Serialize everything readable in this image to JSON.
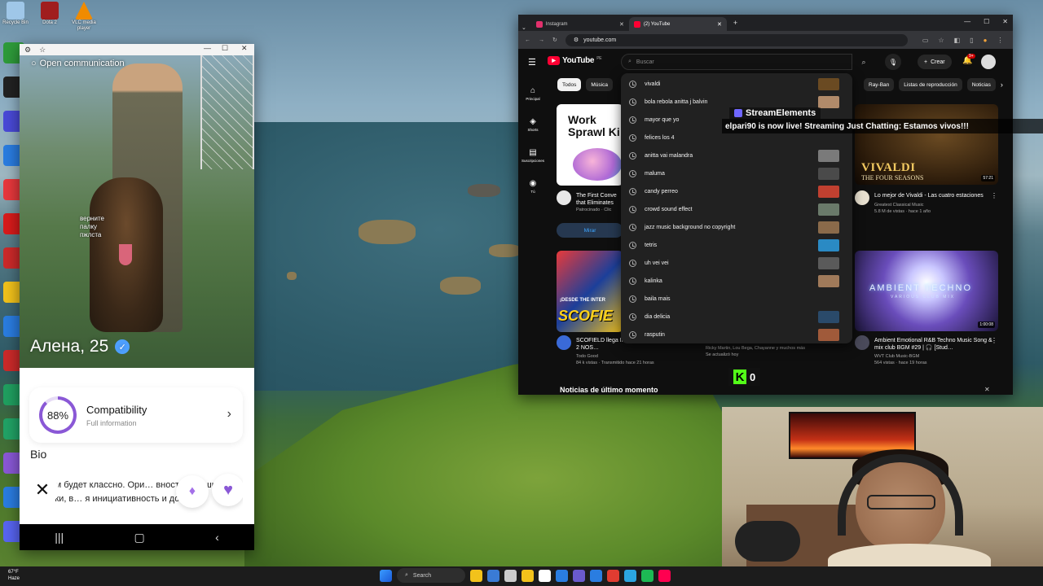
{
  "desktop": {
    "top_icons": [
      {
        "label": "Recycle Bin",
        "color": "#9fc7e8"
      },
      {
        "label": "Dota 2",
        "color": "#a01e1e"
      },
      {
        "label": "VLC media player",
        "color": "#f08b00"
      }
    ],
    "side_icon_colors": [
      "#2e9b3a",
      "#222222",
      "#4a4ad8",
      "#2a7de1",
      "#e8383c",
      "#d81b1b",
      "#cc2a2a",
      "#f2c21b",
      "#2a7de1",
      "#cc2a2a",
      "#20a060",
      "#21a366",
      "#8a58d6",
      "#2a7de1",
      "#5865f2"
    ]
  },
  "phone": {
    "overlay_title": "Open communication",
    "side_note": "верните\nпалку\nпжлста",
    "name": "Алена, 25",
    "verified_icon": "verified-check-icon",
    "compatibility": {
      "percent": "88%",
      "percent_value": 0.88,
      "title": "Compatibility",
      "subtitle": "Full information"
    },
    "bio_label": "Bio",
    "bio_text": "с кем будет классно. Ори… вность, смешные шутки, в… я инициативность и долька",
    "accent": "#8a58d6"
  },
  "browser": {
    "tabs": [
      {
        "label": "Instagram",
        "color": "#e1306c"
      },
      {
        "label": "(2) YouTube",
        "color": "#ff0033"
      }
    ],
    "url": "youtube.com",
    "youtube": {
      "logo": "YouTube",
      "country": "PE",
      "search_placeholder": "Buscar",
      "create_label": "Crear",
      "notif_count": "9+",
      "sidebar": [
        {
          "icon": "home-icon",
          "glyph": "⌂",
          "label": "Principal"
        },
        {
          "icon": "shorts-icon",
          "glyph": "◈",
          "label": "Shorts"
        },
        {
          "icon": "subscriptions-icon",
          "glyph": "▤",
          "label": "Suscripciones"
        },
        {
          "icon": "you-icon",
          "glyph": "◉",
          "label": "Tú"
        }
      ],
      "chips_left": [
        "Todos",
        "Música"
      ],
      "chips_right": [
        "Ray-Ban",
        "Listas de reproducción",
        "Noticias"
      ],
      "suggestions": [
        {
          "text": "vivaldi",
          "thumb": "#6a4a22"
        },
        {
          "text": "bola rebola anitta j balvin",
          "thumb": "#b08a6a"
        },
        {
          "text": "mayor que yo",
          "thumb": ""
        },
        {
          "text": "felices los 4",
          "thumb": ""
        },
        {
          "text": "anitta vai malandra",
          "thumb": "#7a7a7a"
        },
        {
          "text": "maluma",
          "thumb": "#4a4a4a"
        },
        {
          "text": "candy perreo",
          "thumb": "#c04030"
        },
        {
          "text": "crowd sound effect",
          "thumb": "#6a7a6a"
        },
        {
          "text": "jazz music background no copyright",
          "thumb": "#8a6a4a"
        },
        {
          "text": "tetris",
          "thumb": "#2a8ac4"
        },
        {
          "text": "uh vei vei",
          "thumb": "#5a5a5a"
        },
        {
          "text": "kalinka",
          "thumb": "#a07a5a"
        },
        {
          "text": "baila mais",
          "thumb": ""
        },
        {
          "text": "dia delicia",
          "thumb": "#2a4a6a"
        },
        {
          "text": "rasputin",
          "thumb": "#a05a3a"
        }
      ],
      "ad": {
        "headline": "Work Sprawl Ki",
        "title": "The First Conve that Eliminates",
        "sponsor": "Patrocinado · Clic",
        "cta": "Mirar"
      },
      "vivaldi": {
        "thumb_title": "VIVALDI",
        "thumb_sub": "THE FOUR SEASONS",
        "duration": "57:21",
        "title": "Lo mejor de Vivaldi - Las cuatro estaciones",
        "channel": "Greatest Classical Music",
        "stats": "5.8 M de vistas · hace 1 año"
      },
      "scofield": {
        "thumb_top": "¡DESDE THE INTER",
        "thumb_title": "SCOFIE",
        "title": "SCOFIELD llega INTERNATIONAL de DOTA 2 NOS…",
        "channel": "Todo Good",
        "stats": "84 k vistas · Transmitido hace 21 horas"
      },
      "mix": {
        "subtitle": "Ricky Martin, Lou Bega, Chayanne y muchos más",
        "updated": "Se actualizó hoy"
      },
      "ambient": {
        "thumb_title": "AMBIENT TECHNO",
        "thumb_sub": "VARIOUS CLUB MIX",
        "duration": "1:00:08",
        "title": "Ambient Emotional R&B Techno Music Song & mix club BGM #29 | 🎧 [Stud…",
        "channel": "WVT Club Music-BGM",
        "stats": "564 vistas · hace 19 horas"
      },
      "news_heading": "Noticias de último momento"
    }
  },
  "overlays": {
    "streamelements": "StreamElements",
    "live_message": "elpari90 is now live! Streaming Just Chatting: Estamos vivos!!!",
    "kick_count": "0"
  },
  "taskbar": {
    "weather_temp": "67°F",
    "weather_desc": "Haze",
    "search_label": "Search",
    "icon_colors": [
      "#f2c21b",
      "#3a7bd5",
      "#cccccc",
      "#f2c21b",
      "#ffffff",
      "#2a7de1",
      "#6a5acd",
      "#2a7de1",
      "#e03c31",
      "#2ba5e0",
      "#1db954",
      "#ff0050"
    ]
  }
}
